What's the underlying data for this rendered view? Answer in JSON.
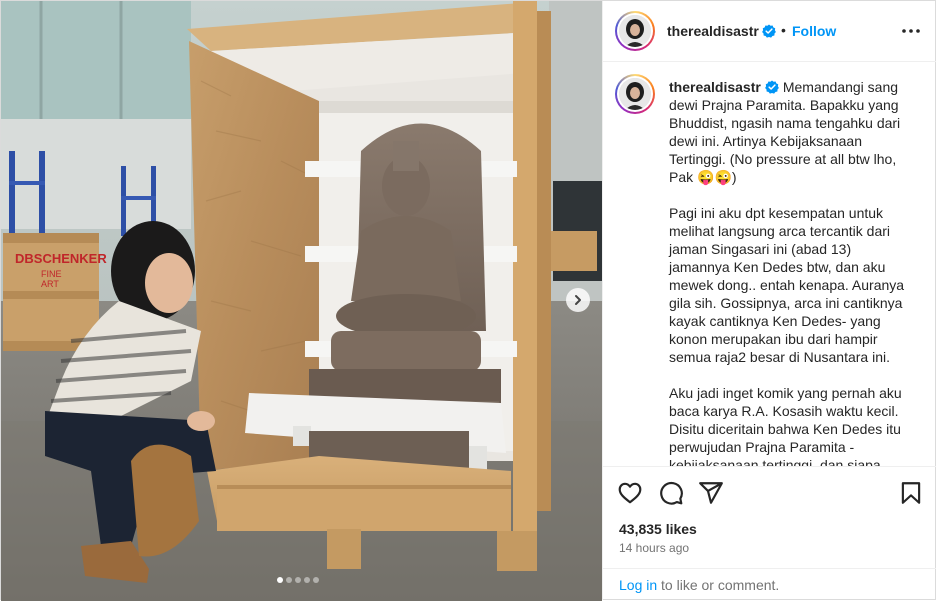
{
  "post": {
    "username": "therealdisastr",
    "verified": true,
    "follow_label": "Follow",
    "bullet": "•"
  },
  "caption": {
    "paragraphs": [
      "Memandangi sang dewi Prajna Paramita. Bapakku yang Bhuddist, ngasih nama tengahku dari dewi ini. Artinya Kebijaksanaan Tertinggi. (No pressure at all btw lho, Pak 😜😜)",
      "Pagi ini aku dpt kesempatan untuk melihat langsung arca tercantik dari jaman Singasari ini (abad 13) jamannya Ken Dedes btw, dan aku mewek dong.. entah kenapa. Auranya gila sih. Gossipnya, arca ini cantiknya kayak cantiknya Ken Dedes- yang konon merupakan ibu dari hampir semua raja2 besar di Nusantara ini.",
      "Aku jadi inget komik yang pernah aku baca karya R.A. Kosasih waktu kecil. Disitu diceritain bahwa Ken Dedes itu perwujudan Prajna Paramita - kebijaksanaan tertinggi, dan siapa"
    ]
  },
  "media": {
    "crate_sign_line1": "DBSCHENKER",
    "crate_sign_line2": "FINE",
    "crate_sign_line3": "ART",
    "carousel_count": 5,
    "carousel_active": 0
  },
  "actions": {
    "likes": "43,835 likes",
    "time": "14 hours ago",
    "icons": [
      "heart-icon",
      "comment-icon",
      "share-icon",
      "bookmark-icon"
    ]
  },
  "footer": {
    "login_link": "Log in",
    "login_rest": " to like or comment."
  },
  "colors": {
    "link_blue": "#0095f6",
    "verified_blue": "#0095f6",
    "muted_text": "#737373"
  }
}
